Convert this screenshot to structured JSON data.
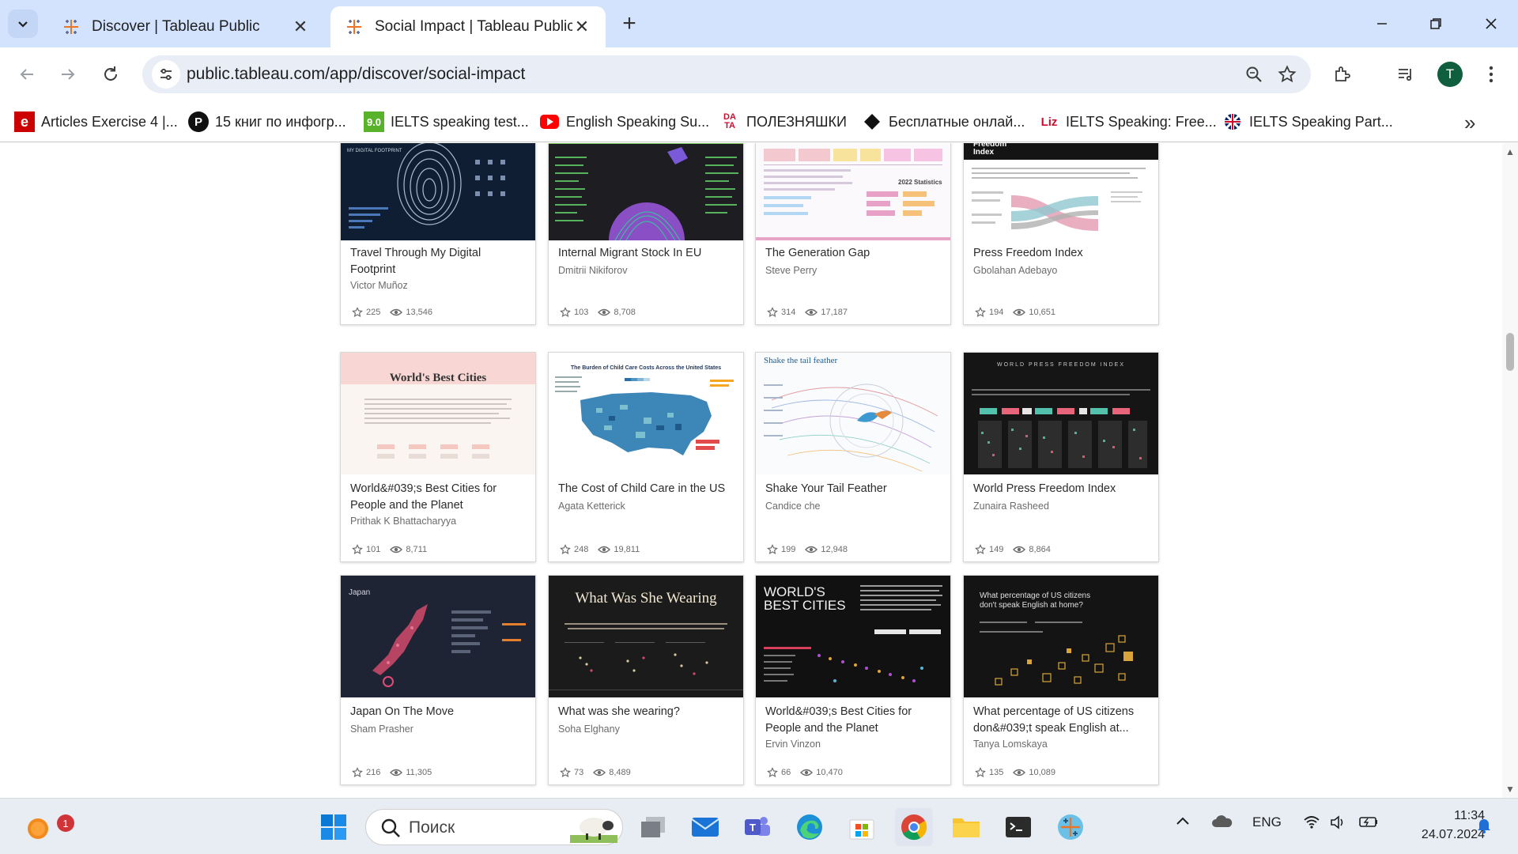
{
  "tabs": [
    {
      "title": "Discover | Tableau Public",
      "active": false
    },
    {
      "title": "Social Impact | Tableau Public",
      "active": true
    }
  ],
  "address_bar": {
    "url": "public.tableau.com/app/discover/social-impact"
  },
  "profile": {
    "initial": "T"
  },
  "bookmarks": [
    {
      "label": "Articles Exercise 4 |...",
      "icon": "e-icon"
    },
    {
      "label": "15 книг по инфогр...",
      "icon": "p-icon"
    },
    {
      "label": "IELTS speaking test...",
      "icon": "ielts9-icon"
    },
    {
      "label": "English Speaking Su...",
      "icon": "youtube-icon"
    },
    {
      "label": "ПОЛЕЗНЯШКИ",
      "icon": "data-icon"
    },
    {
      "label": "Бесплатные онлай...",
      "icon": "diamond-icon"
    },
    {
      "label": "IELTS Speaking: Free...",
      "icon": "liz-icon"
    },
    {
      "label": "IELTS Speaking Part...",
      "icon": "uk-flag-icon"
    }
  ],
  "visualizations": [
    {
      "title": "Travel Through My Digital Footprint",
      "author": "Victor Muñoz",
      "favorites": "225",
      "views": "13,546",
      "thumb_text": "MY DIGITAL FOOTPRINT"
    },
    {
      "title": "Internal Migrant Stock In EU",
      "author": "Dmitrii Nikiforov",
      "favorites": "103",
      "views": "8,708",
      "thumb_text": ""
    },
    {
      "title": "The Generation Gap",
      "author": "Steve Perry",
      "favorites": "314",
      "views": "17,187",
      "thumb_text": "2022 Statistics"
    },
    {
      "title": "Press Freedom Index",
      "author": "Gbolahan Adebayo",
      "favorites": "194",
      "views": "10,651",
      "thumb_text": "Freedom Index"
    },
    {
      "title": "World&#039;s Best Cities for People and the Planet",
      "author": "Prithak K Bhattacharyya",
      "favorites": "101",
      "views": "8,711",
      "thumb_text": "World's Best Cities"
    },
    {
      "title": "The Cost of Child Care in the US",
      "author": "Agata Ketterick",
      "favorites": "248",
      "views": "19,811",
      "thumb_text": "The Burden of Child Care Costs Across the United States"
    },
    {
      "title": "Shake Your Tail Feather",
      "author": "Candice che",
      "favorites": "199",
      "views": "12,948",
      "thumb_text": "Shake the tail feather"
    },
    {
      "title": "World Press Freedom Index",
      "author": "Zunaira Rasheed",
      "favorites": "149",
      "views": "8,864",
      "thumb_text": "WORLD PRESS FREEDOM INDEX"
    },
    {
      "title": "Japan On The Move",
      "author": "Sham Prasher",
      "favorites": "216",
      "views": "11,305",
      "thumb_text": "Japan"
    },
    {
      "title": "What was she wearing?",
      "author": "Soha Elghany",
      "favorites": "73",
      "views": "8,489",
      "thumb_text": "What Was She Wearing"
    },
    {
      "title": "World&#039;s Best Cities for People and the Planet",
      "author": "Ervin Vinzon",
      "favorites": "66",
      "views": "10,470",
      "thumb_text": "WORLD'S BEST CITIES"
    },
    {
      "title": "What percentage of US citizens don&#039;t speak English at...",
      "author": "Tanya Lomskaya",
      "favorites": "135",
      "views": "10,089",
      "thumb_text": "What percentage of US citizens don't speak English at home?"
    }
  ],
  "taskbar": {
    "search_placeholder": "Поиск",
    "notification_count": "1",
    "language": "ENG",
    "time": "11:34",
    "date": "24.07.2024"
  },
  "colors": {
    "tabstrip": "#d3e3fd",
    "omnibox": "#e9eef6",
    "taskbar": "#e8edf4"
  }
}
